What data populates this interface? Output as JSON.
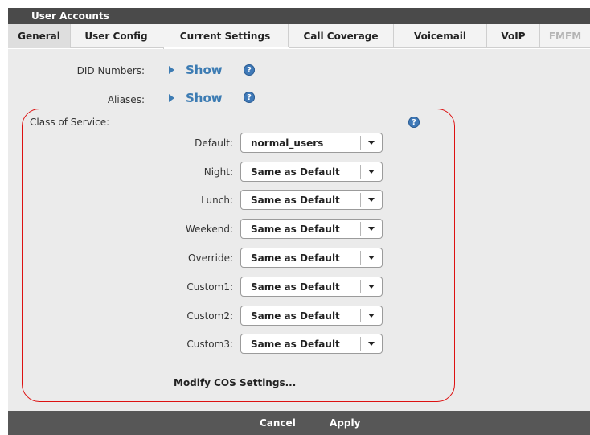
{
  "window": {
    "title": "User Accounts"
  },
  "tabs": [
    {
      "label": "General",
      "active": true,
      "disabled": false
    },
    {
      "label": "User Config",
      "active": false,
      "disabled": false
    },
    {
      "label": "Current Settings",
      "active": false,
      "disabled": false
    },
    {
      "label": "Call Coverage",
      "active": false,
      "disabled": false
    },
    {
      "label": "Voicemail",
      "active": false,
      "disabled": false
    },
    {
      "label": "VoIP",
      "active": false,
      "disabled": false
    },
    {
      "label": "FMFM",
      "active": false,
      "disabled": true
    }
  ],
  "did_numbers": {
    "label": "DID Numbers:",
    "link": "Show"
  },
  "aliases": {
    "label": "Aliases:",
    "link": "Show"
  },
  "class_of_service": {
    "title": "Class of Service:",
    "rows": [
      {
        "label": "Default:",
        "value": "normal_users"
      },
      {
        "label": "Night:",
        "value": "Same as Default"
      },
      {
        "label": "Lunch:",
        "value": "Same as Default"
      },
      {
        "label": "Weekend:",
        "value": "Same as Default"
      },
      {
        "label": "Override:",
        "value": "Same as Default"
      },
      {
        "label": "Custom1:",
        "value": "Same as Default"
      },
      {
        "label": "Custom2:",
        "value": "Same as Default"
      },
      {
        "label": "Custom3:",
        "value": "Same as Default"
      }
    ],
    "modify_link": "Modify COS Settings..."
  },
  "footer": {
    "cancel_label": "Cancel",
    "apply_label": "Apply"
  },
  "icons": {
    "help": "help-icon",
    "expand": "triangle-right-icon",
    "dropdown": "chevron-down-icon"
  },
  "colors": {
    "accent": "#3d7cb3",
    "cos_border": "#dd1111",
    "header": "#4a4a4a"
  }
}
